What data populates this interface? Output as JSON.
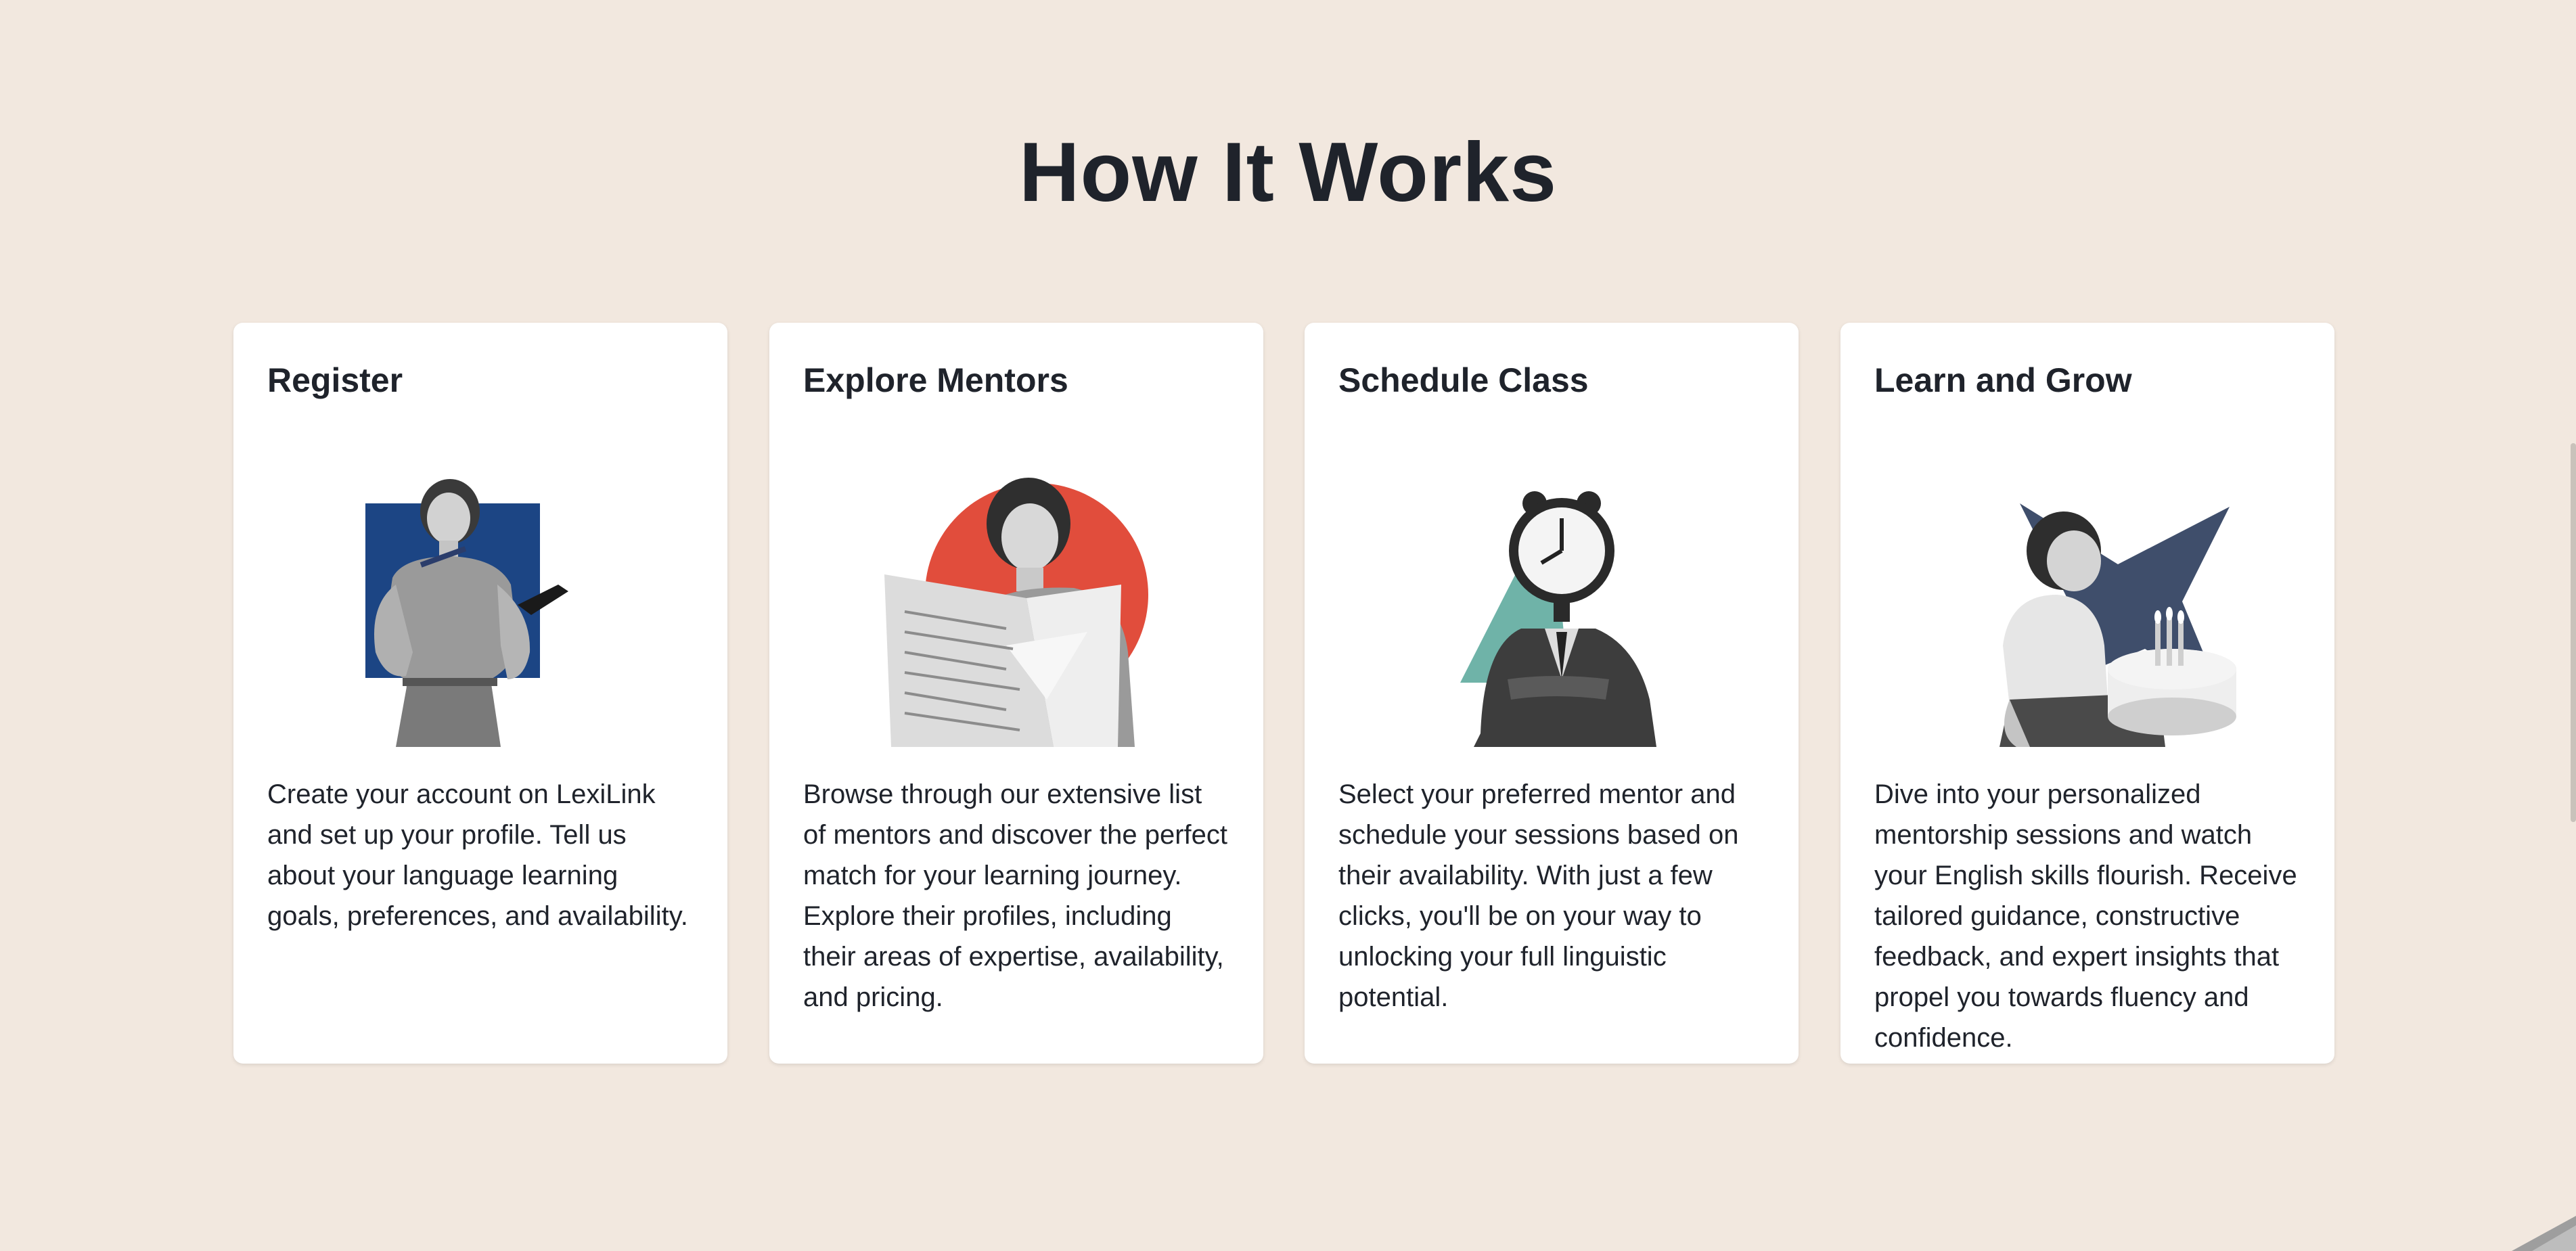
{
  "section": {
    "title": "How It Works"
  },
  "steps": [
    {
      "title": "Register",
      "description": "Create your account on LexiLink and set up your profile. Tell us about your language learning goals, preferences, and availability.",
      "image": "woman-with-book-illustration",
      "accent_color": "#1c4584"
    },
    {
      "title": "Explore Mentors",
      "description": "Browse through our extensive list of mentors and discover the perfect match for your learning journey. Explore their profiles, including their areas of expertise, availability, and pricing.",
      "image": "woman-reading-newspaper-illustration",
      "accent_color": "#e14d3c"
    },
    {
      "title": "Schedule Class",
      "description": "Select your preferred mentor and schedule your sessions based on their availability. With just a few clicks, you'll be on your way to unlocking your full linguistic potential.",
      "image": "clock-head-man-illustration",
      "accent_color": "#6fb3a8"
    },
    {
      "title": "Learn and Grow",
      "description": "Dive into your personalized mentorship sessions and watch your English skills flourish. Receive tailored guidance, constructive feedback, and expert insights that propel you towards fluency and confidence.",
      "image": "boy-with-birthday-cake-illustration",
      "accent_color": "#3f4e6b"
    }
  ]
}
